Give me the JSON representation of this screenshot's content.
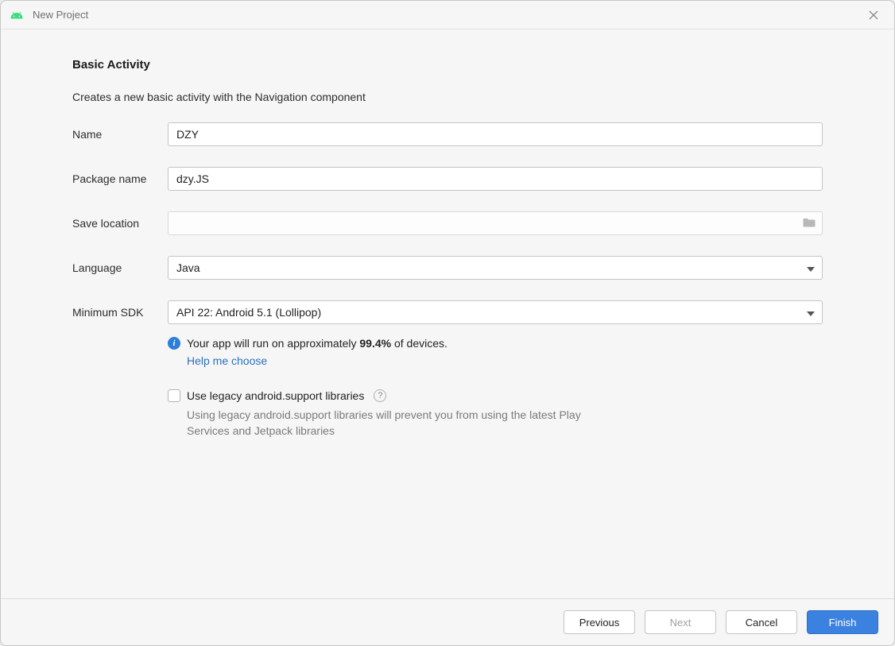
{
  "window": {
    "title": "New Project"
  },
  "page": {
    "heading": "Basic Activity",
    "description": "Creates a new basic activity with the Navigation component"
  },
  "form": {
    "name_label": "Name",
    "name_value": "DZY",
    "package_label": "Package name",
    "package_value": "dzy.JS",
    "save_label": "Save location",
    "save_value": "",
    "language_label": "Language",
    "language_value": "Java",
    "sdk_label": "Minimum SDK",
    "sdk_value": "API 22: Android 5.1 (Lollipop)"
  },
  "info": {
    "text_before": "Your app will run on approximately ",
    "percent": "99.4%",
    "text_after": " of devices.",
    "help_link": "Help me choose"
  },
  "legacy": {
    "checkbox_label": "Use legacy android.support libraries",
    "note": "Using legacy android.support libraries will prevent you from using the latest Play Services and Jetpack libraries"
  },
  "footer": {
    "previous": "Previous",
    "next": "Next",
    "cancel": "Cancel",
    "finish": "Finish"
  }
}
